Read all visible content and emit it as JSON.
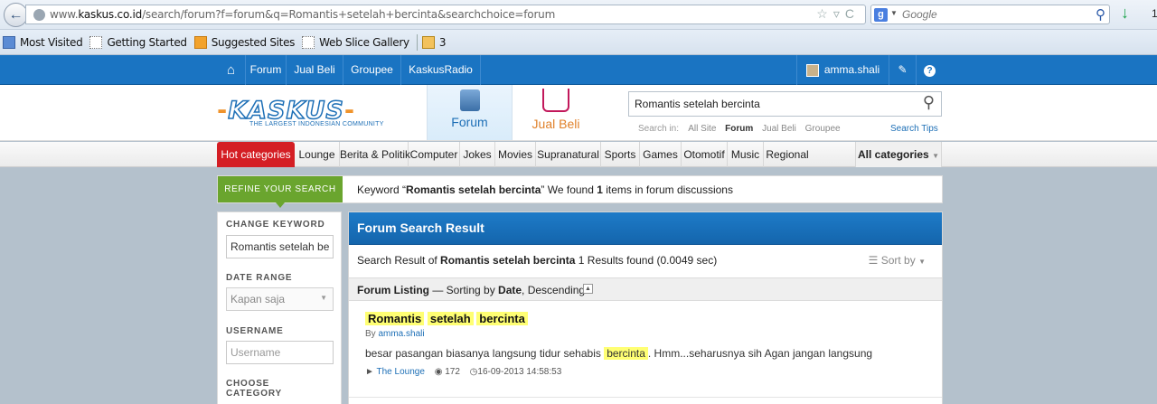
{
  "browser": {
    "url_prefix": "www.",
    "url_domain": "kaskus.co.id",
    "url_rest": "/search/forum?f=forum&q=Romantis+setelah+bercinta&searchchoice=forum",
    "search_engine_placeholder": "Google",
    "right_number": "1",
    "bookmarks": [
      "Most Visited",
      "Getting Started",
      "Suggested Sites",
      "Web Slice Gallery",
      "3"
    ]
  },
  "topnav": {
    "items": [
      "Forum",
      "Jual Beli",
      "Groupee",
      "KaskusRadio"
    ],
    "username": "amma.shali"
  },
  "header": {
    "logo_text": "KASKUS",
    "logo_tagline": "THE LARGEST INDONESIAN COMMUNITY",
    "tab_forum": "Forum",
    "tab_jualbeli": "Jual Beli",
    "search_value": "Romantis setelah bercinta",
    "search_in_label": "Search in:",
    "search_in_options": [
      "All Site",
      "Forum",
      "Jual Beli",
      "Groupee"
    ],
    "search_tips": "Search Tips"
  },
  "categories": {
    "hot": "Hot categories",
    "items": [
      "Lounge",
      "Berita & Politik",
      "Computer",
      "Jokes",
      "Movies",
      "Supranatural",
      "Sports",
      "Games",
      "Otomotif",
      "Music",
      "Regional"
    ],
    "all": "All categories"
  },
  "refine": {
    "button": "REFINE YOUR SEARCH",
    "msg_prefix": "Keyword “",
    "keyword": "Romantis setelah bercinta",
    "msg_mid": "” We found ",
    "count": "1",
    "msg_suffix": " items in forum discussions"
  },
  "sidebar": {
    "change_keyword_label": "CHANGE KEYWORD",
    "keyword_value": "Romantis setelah be",
    "date_range_label": "DATE RANGE",
    "date_range_value": "Kapan saja",
    "username_label": "USERNAME",
    "username_placeholder": "Username",
    "choose_category_label_1": "CHOOSE",
    "choose_category_label_2": "CATEGORY"
  },
  "main": {
    "title": "Forum Search Result",
    "sum_prefix": "Search Result of ",
    "sum_keyword": "Romantis setelah bercinta",
    "sum_suffix": " 1 Results found (0.0049 sec)",
    "sort_by": "Sort by",
    "listing_label": "Forum Listing",
    "listing_sort_prefix": " — Sorting by ",
    "listing_sort_field": "Date",
    "listing_sort_order": ", Descending",
    "result": {
      "title_words": [
        "Romantis",
        "setelah",
        "bercinta"
      ],
      "by_prefix": "By ",
      "author": "amma.shali",
      "snippet_before": "besar pasangan biasanya langsung tidur sehabis ",
      "snippet_highlight": "bercinta",
      "snippet_after": ". Hmm...seharusnya sih Agan jangan langsung",
      "category": "The Lounge",
      "replies": "172",
      "datetime": "16-09-2013 14:58:53"
    }
  }
}
